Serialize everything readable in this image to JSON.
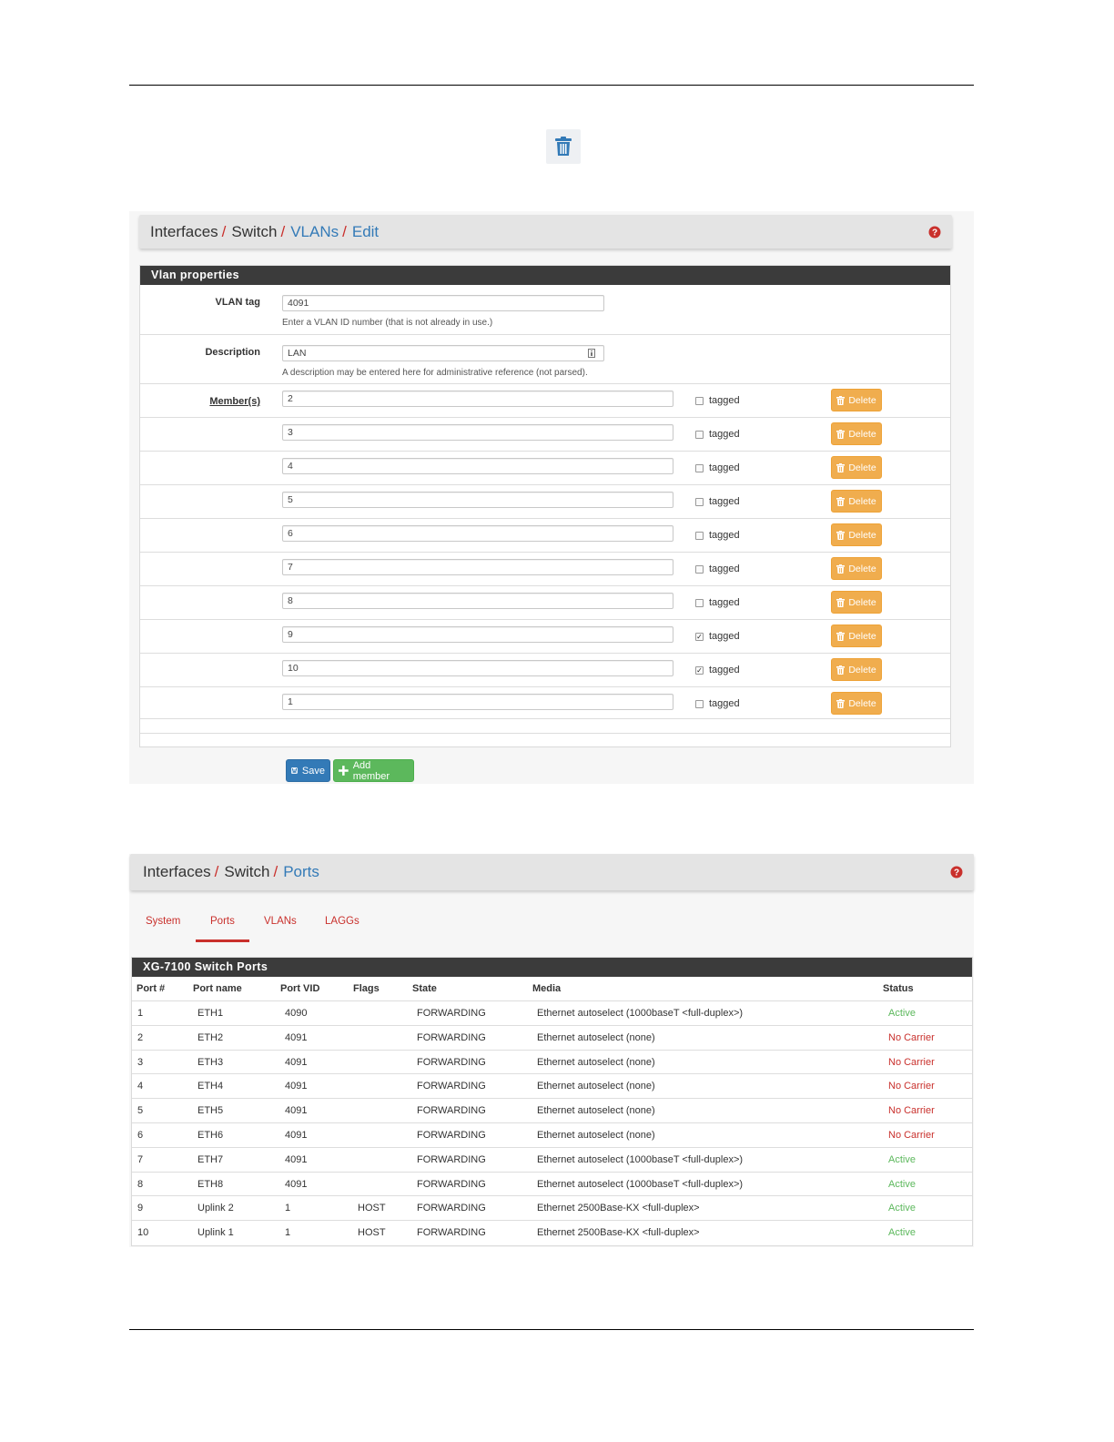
{
  "vlan_edit": {
    "breadcrumb": [
      "Interfaces",
      "Switch",
      "VLANs",
      "Edit"
    ],
    "panel_title": "Vlan properties",
    "vlan_tag": {
      "label": "VLAN tag",
      "value": "4091",
      "help": "Enter a VLAN ID number (that is not already in use.)"
    },
    "description": {
      "label": "Description",
      "value": "LAN",
      "help": "A description may be entered here for administrative reference (not parsed)."
    },
    "members_label": "Member(s)",
    "tagged_label": "tagged",
    "delete_label": "Delete",
    "members": [
      {
        "port": "2",
        "tagged": false
      },
      {
        "port": "3",
        "tagged": false
      },
      {
        "port": "4",
        "tagged": false
      },
      {
        "port": "5",
        "tagged": false
      },
      {
        "port": "6",
        "tagged": false
      },
      {
        "port": "7",
        "tagged": false
      },
      {
        "port": "8",
        "tagged": false
      },
      {
        "port": "9",
        "tagged": true
      },
      {
        "port": "10",
        "tagged": true
      },
      {
        "port": "1",
        "tagged": false
      }
    ],
    "save_label": "Save",
    "add_member_label": "Add member"
  },
  "ports_page": {
    "breadcrumb": [
      "Interfaces",
      "Switch",
      "Ports"
    ],
    "tabs": [
      "System",
      "Ports",
      "VLANs",
      "LAGGs"
    ],
    "active_tab": "Ports",
    "panel_title": "XG-7100 Switch Ports",
    "columns": [
      "Port #",
      "Port name",
      "Port VID",
      "Flags",
      "State",
      "Media",
      "Status"
    ],
    "rows": [
      {
        "port": "1",
        "name": "ETH1",
        "vid": "4090",
        "flags": "",
        "state": "FORWARDING",
        "media": "Ethernet autoselect (1000baseT <full-duplex>)",
        "status": "Active"
      },
      {
        "port": "2",
        "name": "ETH2",
        "vid": "4091",
        "flags": "",
        "state": "FORWARDING",
        "media": "Ethernet autoselect (none)",
        "status": "No Carrier"
      },
      {
        "port": "3",
        "name": "ETH3",
        "vid": "4091",
        "flags": "",
        "state": "FORWARDING",
        "media": "Ethernet autoselect (none)",
        "status": "No Carrier"
      },
      {
        "port": "4",
        "name": "ETH4",
        "vid": "4091",
        "flags": "",
        "state": "FORWARDING",
        "media": "Ethernet autoselect (none)",
        "status": "No Carrier"
      },
      {
        "port": "5",
        "name": "ETH5",
        "vid": "4091",
        "flags": "",
        "state": "FORWARDING",
        "media": "Ethernet autoselect (none)",
        "status": "No Carrier"
      },
      {
        "port": "6",
        "name": "ETH6",
        "vid": "4091",
        "flags": "",
        "state": "FORWARDING",
        "media": "Ethernet autoselect (none)",
        "status": "No Carrier"
      },
      {
        "port": "7",
        "name": "ETH7",
        "vid": "4091",
        "flags": "",
        "state": "FORWARDING",
        "media": "Ethernet autoselect (1000baseT <full-duplex>)",
        "status": "Active"
      },
      {
        "port": "8",
        "name": "ETH8",
        "vid": "4091",
        "flags": "",
        "state": "FORWARDING",
        "media": "Ethernet autoselect (1000baseT <full-duplex>)",
        "status": "Active"
      },
      {
        "port": "9",
        "name": "Uplink 2",
        "vid": "1",
        "flags": "HOST",
        "state": "FORWARDING",
        "media": "Ethernet 2500Base-KX <full-duplex>",
        "status": "Active"
      },
      {
        "port": "10",
        "name": "Uplink 1",
        "vid": "1",
        "flags": "HOST",
        "state": "FORWARDING",
        "media": "Ethernet 2500Base-KX <full-duplex>",
        "status": "Active"
      }
    ]
  },
  "colors": {
    "link": "#337ab7",
    "danger": "#c9302c",
    "success": "#5cb85c",
    "warning": "#f0ad4e",
    "panel_head": "#3b3b3b"
  },
  "icons": [
    "trash-icon",
    "help-icon",
    "save-icon",
    "plus-icon"
  ]
}
